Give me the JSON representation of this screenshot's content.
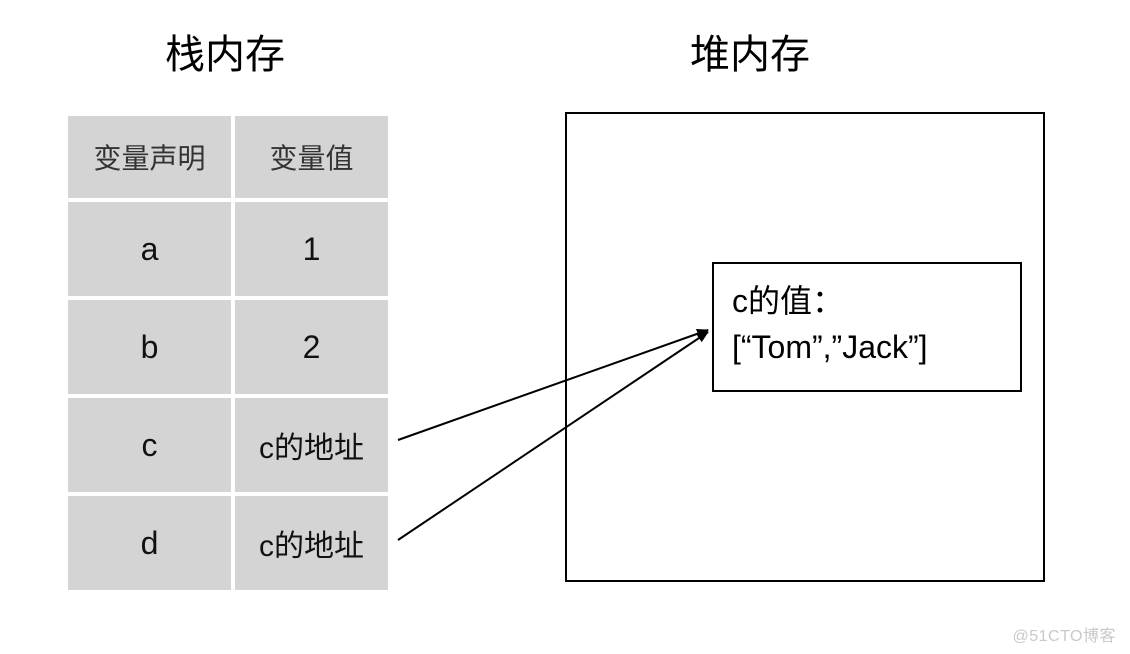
{
  "titles": {
    "stack": "栈内存",
    "heap": "堆内存"
  },
  "stack": {
    "headers": {
      "col1": "变量声明",
      "col2": "变量值"
    },
    "rows": [
      {
        "name": "a",
        "value": "1"
      },
      {
        "name": "b",
        "value": "2"
      },
      {
        "name": "c",
        "value": "c的地址"
      },
      {
        "name": "d",
        "value": "c的地址"
      }
    ]
  },
  "heap": {
    "inner_label": "c的值：",
    "inner_value": "[“Tom”,”Jack”]"
  },
  "watermark": "@51CTO博客"
}
